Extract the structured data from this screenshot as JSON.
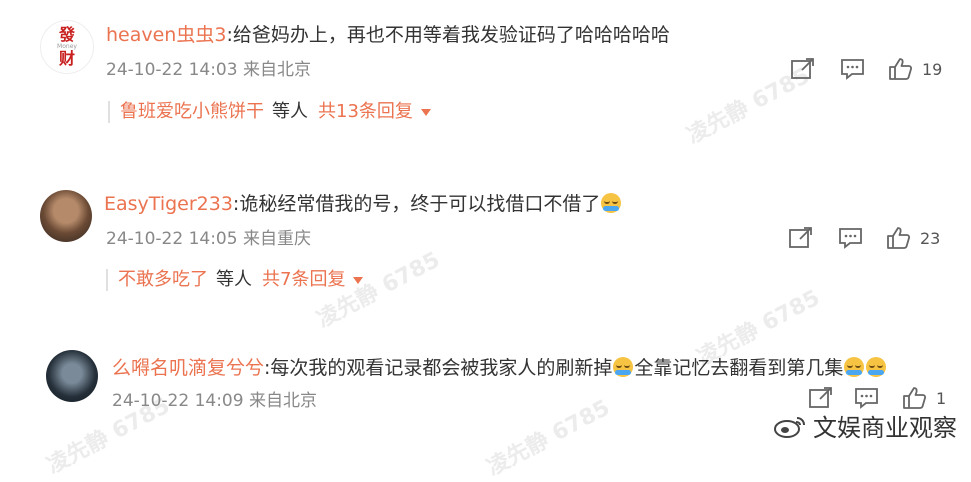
{
  "watermark": "凌先静 6785",
  "brand": {
    "name": "文娱商业观察"
  },
  "colors": {
    "accent": "#eb7350",
    "meta": "#888888"
  },
  "comments": [
    {
      "avatar_text_top": "發",
      "avatar_text_mid": "Money",
      "avatar_text_bottom": "财",
      "username": "heaven虫虫3",
      "text": ":给爸妈办上，再也不用等着我发验证码了哈哈哈哈哈",
      "time": "24-10-22 14:03",
      "location": "来自北京",
      "likes": "19",
      "reply_user": "鲁班爱吃小熊饼干",
      "reply_etc": "等人",
      "reply_more": "共13条回复"
    },
    {
      "username": "EasyTiger233",
      "text": ":诡秘经常借我的号，终于可以找借口不借了",
      "time": "24-10-22 14:05",
      "location": "来自重庆",
      "likes": "23",
      "reply_user": "不敢多吃了",
      "reply_etc": "等人",
      "reply_more": "共7条回复"
    },
    {
      "username": "么嘚名叽滴复兮兮",
      "text_a": ":每次我的观看记录都会被我家人的刷新掉",
      "text_b": "全靠记忆去翻看到第几集",
      "time": "24-10-22 14:09",
      "location": "来自北京",
      "likes": "1"
    }
  ]
}
